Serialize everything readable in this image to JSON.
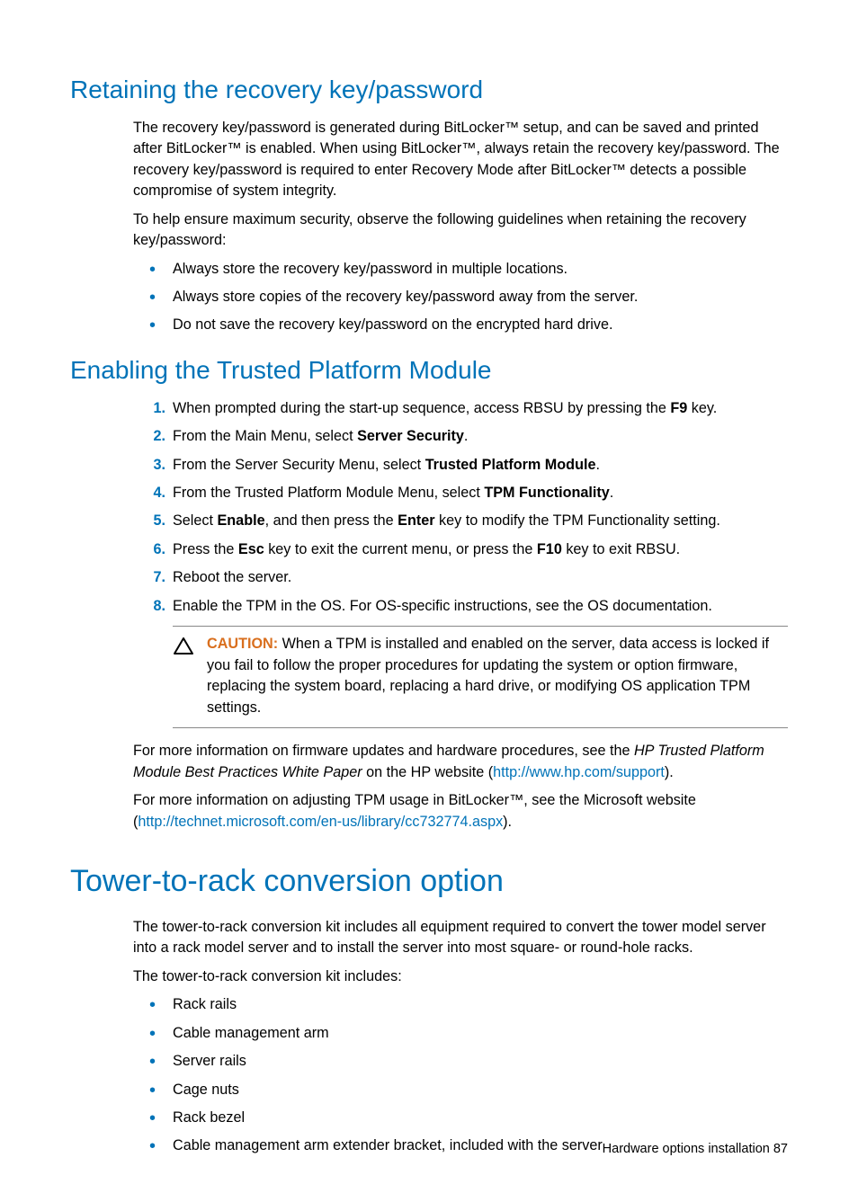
{
  "section1": {
    "title": "Retaining the recovery key/password",
    "para1": "The recovery key/password is generated during BitLocker™ setup, and can be saved and printed after BitLocker™ is enabled. When using BitLocker™, always retain the recovery key/password. The recovery key/password is required to enter Recovery Mode after BitLocker™ detects a possible compromise of system integrity.",
    "para2": "To help ensure maximum security, observe the following guidelines when retaining the recovery key/password:",
    "bullets": [
      "Always store the recovery key/password in multiple locations.",
      "Always store copies of the recovery key/password away from the server.",
      "Do not save the recovery key/password on the encrypted hard drive."
    ]
  },
  "section2": {
    "title": "Enabling the Trusted Platform Module",
    "steps": {
      "s1_a": "When prompted during the start-up sequence, access RBSU by pressing the ",
      "s1_b": "F9",
      "s1_c": " key.",
      "s2_a": "From the Main Menu, select ",
      "s2_b": "Server Security",
      "s2_c": ".",
      "s3_a": "From the Server Security Menu, select ",
      "s3_b": "Trusted Platform Module",
      "s3_c": ".",
      "s4_a": "From the Trusted Platform Module Menu, select ",
      "s4_b": "TPM Functionality",
      "s4_c": ".",
      "s5_a": "Select ",
      "s5_b": "Enable",
      "s5_c": ", and then press the ",
      "s5_d": "Enter",
      "s5_e": " key to modify the TPM Functionality setting.",
      "s6_a": "Press the ",
      "s6_b": "Esc",
      "s6_c": " key to exit the current menu, or press the ",
      "s6_d": "F10",
      "s6_e": " key to exit RBSU.",
      "s7": "Reboot the server.",
      "s8": "Enable the TPM in the OS. For OS-specific instructions, see the OS documentation."
    },
    "caution": {
      "label": "CAUTION:",
      "text": "  When a TPM is installed and enabled on the server, data access is locked if you fail to follow the proper procedures for updating the system or option firmware, replacing the system board, replacing a hard drive, or modifying OS application TPM settings."
    },
    "after1_a": "For more information on firmware updates and hardware procedures, see the ",
    "after1_b": "HP Trusted Platform Module Best Practices White Paper",
    "after1_c": " on the HP website (",
    "after1_link": "http://www.hp.com/support",
    "after1_d": ").",
    "after2_a": "For more information on adjusting TPM usage in BitLocker™, see the Microsoft website (",
    "after2_link": "http://technet.microsoft.com/en-us/library/cc732774.aspx",
    "after2_b": ")."
  },
  "section3": {
    "title": "Tower-to-rack conversion option",
    "para1": "The tower-to-rack conversion kit includes all equipment required to convert the tower model server into a rack model server and to install the server into most square- or round-hole racks.",
    "para2": "The tower-to-rack conversion kit includes:",
    "bullets": [
      "Rack rails",
      "Cable management arm",
      "Server rails",
      "Cage nuts",
      "Rack bezel",
      "Cable management arm extender bracket, included with the server"
    ]
  },
  "footer": {
    "text": "Hardware options installation   87"
  }
}
